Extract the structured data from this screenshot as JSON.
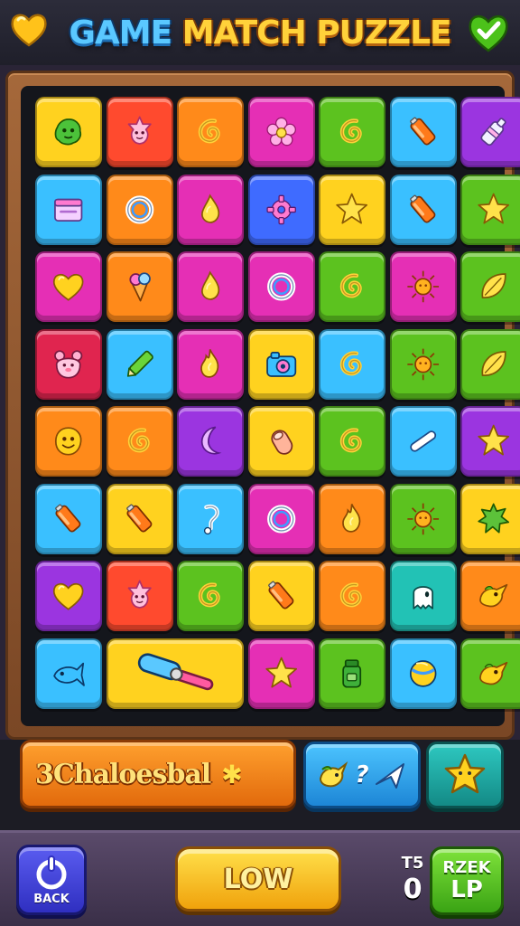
{
  "header": {
    "title_part1": "GAME",
    "title_part2": "MATCH PUZZLE",
    "left_icon": "heart-icon",
    "right_icon": "check-icon"
  },
  "colors": {
    "yellow": "#ffd21f",
    "orange": "#ff8a1a",
    "red": "#ff4a2e",
    "magenta": "#e52fb5",
    "purple": "#9b35e0",
    "green": "#5cc21f",
    "cyan": "#3ac0ff",
    "blue": "#3f6bff",
    "teal": "#22c2b5",
    "crimson": "#e0254f"
  },
  "board": {
    "rows": [
      [
        {
          "color": "yellow",
          "icon": "green-blob-icon"
        },
        {
          "color": "red",
          "icon": "pink-face-icon"
        },
        {
          "color": "orange",
          "icon": "swirl-icon"
        },
        {
          "color": "magenta",
          "icon": "flower-icon"
        },
        {
          "color": "green",
          "icon": "swirl-icon"
        },
        {
          "color": "cyan",
          "icon": "battery-icon"
        },
        {
          "color": "purple",
          "icon": "bottle-icon"
        }
      ],
      [
        {
          "color": "cyan",
          "icon": "box-icon"
        },
        {
          "color": "orange",
          "icon": "ring-icon"
        },
        {
          "color": "magenta",
          "icon": "drop-icon"
        },
        {
          "color": "blue",
          "icon": "gear-icon"
        },
        {
          "color": "yellow",
          "icon": "star-icon"
        },
        {
          "color": "cyan",
          "icon": "battery-icon"
        },
        {
          "color": "green",
          "icon": "star-icon"
        }
      ],
      [
        {
          "color": "magenta",
          "icon": "heart-icon"
        },
        {
          "color": "orange",
          "icon": "cone-icon"
        },
        {
          "color": "magenta",
          "icon": "drop-icon"
        },
        {
          "color": "magenta",
          "icon": "ring-icon"
        },
        {
          "color": "green",
          "icon": "swirl-icon"
        },
        {
          "color": "magenta",
          "icon": "sun-icon"
        },
        {
          "color": "green",
          "icon": "leaf-icon"
        }
      ],
      [
        {
          "color": "crimson",
          "icon": "bear-icon"
        },
        {
          "color": "cyan",
          "icon": "crayon-icon"
        },
        {
          "color": "magenta",
          "icon": "flame-icon"
        },
        {
          "color": "yellow",
          "icon": "camera-icon"
        },
        {
          "color": "cyan",
          "icon": "swirl-icon"
        },
        {
          "color": "green",
          "icon": "sun-icon"
        },
        {
          "color": "green",
          "icon": "leaf-icon"
        }
      ],
      [
        {
          "color": "orange",
          "icon": "smiley-icon"
        },
        {
          "color": "orange",
          "icon": "swirl-icon"
        },
        {
          "color": "purple",
          "icon": "moon-icon"
        },
        {
          "color": "yellow",
          "icon": "thumb-icon"
        },
        {
          "color": "green",
          "icon": "swirl-icon"
        },
        {
          "color": "cyan",
          "icon": "stick-icon"
        },
        {
          "color": "purple",
          "icon": "star-icon"
        }
      ],
      [
        {
          "color": "cyan",
          "icon": "battery-icon"
        },
        {
          "color": "yellow",
          "icon": "battery-icon"
        },
        {
          "color": "cyan",
          "icon": "note-icon"
        },
        {
          "color": "magenta",
          "icon": "ring-icon"
        },
        {
          "color": "orange",
          "icon": "flame-icon"
        },
        {
          "color": "green",
          "icon": "sun-icon"
        },
        {
          "color": "yellow",
          "icon": "splat-icon"
        }
      ],
      [
        {
          "color": "purple",
          "icon": "heart-icon"
        },
        {
          "color": "red",
          "icon": "pink-face-icon"
        },
        {
          "color": "green",
          "icon": "swirl-icon"
        },
        {
          "color": "yellow",
          "icon": "battery-icon"
        },
        {
          "color": "orange",
          "icon": "swirl-icon"
        },
        {
          "color": "teal",
          "icon": "ghost-icon"
        },
        {
          "color": "orange",
          "icon": "bird-icon"
        }
      ],
      [
        {
          "color": "cyan",
          "icon": "fish-icon"
        },
        {
          "color": "yellow",
          "icon": "wide-hammer-icon",
          "span": 2
        },
        {
          "color": "magenta",
          "icon": "star-icon"
        },
        {
          "color": "green",
          "icon": "jar-icon"
        },
        {
          "color": "cyan",
          "icon": "ball-icon"
        },
        {
          "color": "green",
          "icon": "bird-icon"
        }
      ]
    ]
  },
  "combo": {
    "label": "3Chaloesbal",
    "star": "✱"
  },
  "hint": {
    "label": "?",
    "icon": "bird-icon"
  },
  "bonus": {
    "icon": "star-icon"
  },
  "footer": {
    "back_label": "BACK",
    "play_label": "LOW",
    "score_label": "T5",
    "score_value": "0",
    "level_top": "RZEK",
    "level_bottom": "LP"
  }
}
